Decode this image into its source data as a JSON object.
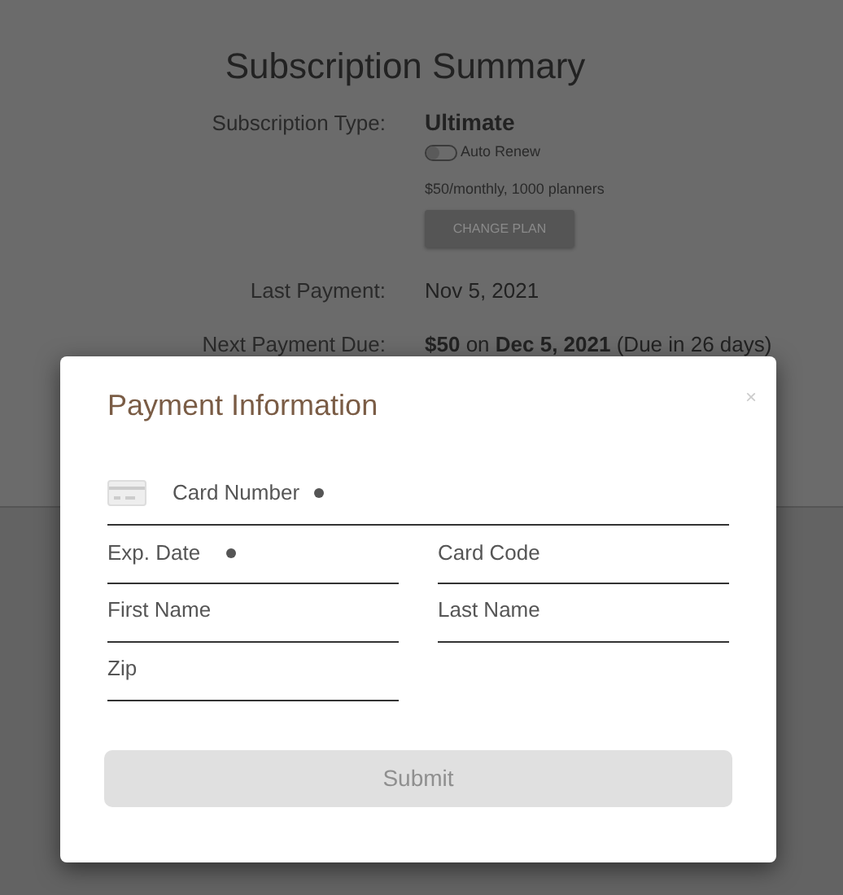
{
  "summary": {
    "title": "Subscription Summary",
    "rows": [
      {
        "kind": "plan",
        "label": "Subscription Type:",
        "value": "Ultimate",
        "auto_renew": {
          "label": "Auto Renew",
          "on": false
        },
        "details": "$50/monthly, 1000 planners",
        "button": "CHANGE PLAN"
      },
      {
        "kind": "text",
        "label": "Last Payment:",
        "value": "Nov 5, 2021"
      },
      {
        "kind": "text",
        "label": "Next Payment Due:",
        "value": "**$50** on **Dec 5, 2021** (Due in 26 days)"
      }
    ]
  },
  "modal": {
    "title": "Payment Information",
    "close": "×",
    "fields": [
      {
        "placeholder": "Card Number",
        "required": true
      },
      {
        "placeholder": "Exp. Date",
        "required": true
      },
      {
        "placeholder": "Card Code",
        "required": false
      },
      {
        "placeholder": "First Name",
        "required": false
      },
      {
        "placeholder": "Last Name",
        "required": false
      },
      {
        "placeholder": "Zip",
        "required": false
      }
    ],
    "submit": {
      "label": "Submit",
      "disabled": true
    }
  }
}
